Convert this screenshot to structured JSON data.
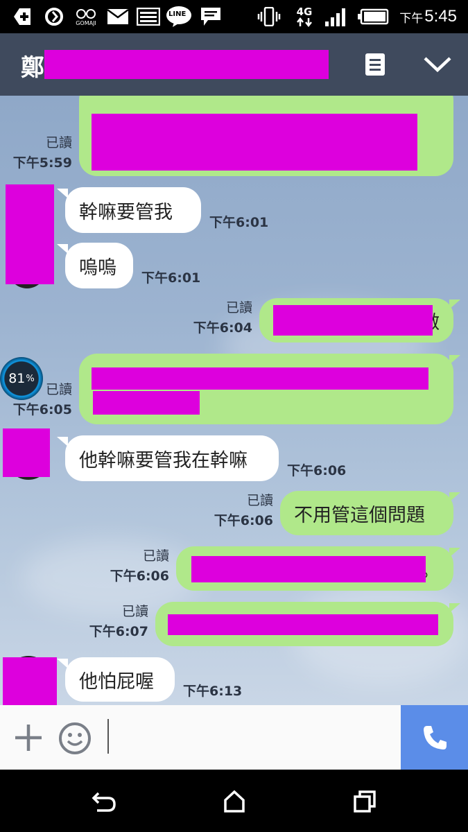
{
  "status_bar": {
    "time_prefix": "下午",
    "time": "5:45",
    "network_label": "4G",
    "app_label": "GOMAJI",
    "line_label": "LINE"
  },
  "header": {
    "title_visible": "鄭",
    "icons": [
      "notes-icon",
      "chevron-down-icon"
    ]
  },
  "messages": [
    {
      "dir": "out",
      "text": "",
      "read": "已讀",
      "time": "下午5:59"
    },
    {
      "dir": "in",
      "text": "幹嘛要管我",
      "time": "下午6:01"
    },
    {
      "dir": "in",
      "text": "嗚嗚",
      "time": "下午6:01"
    },
    {
      "dir": "out",
      "text": "",
      "suffix": "做",
      "read": "已讀",
      "time": "下午6:04"
    },
    {
      "dir": "out",
      "text": "",
      "read": "已讀",
      "time": "下午6:05"
    },
    {
      "dir": "in",
      "text": "他幹嘛要管我在幹嘛",
      "time": "下午6:06"
    },
    {
      "dir": "out",
      "text": "不用管這個問題",
      "read": "已讀",
      "time": "下午6:06"
    },
    {
      "dir": "out",
      "text": "",
      "suffix": "。",
      "read": "已讀",
      "time": "下午6:06"
    },
    {
      "dir": "out",
      "text": "",
      "read": "已讀",
      "time": "下午6:07"
    },
    {
      "dir": "in",
      "text": "他怕屁喔",
      "time": "下午6:13"
    }
  ],
  "battery_widget": {
    "value": "81",
    "unit": "%"
  },
  "colors": {
    "header_bg": "#3f4a5d",
    "out_bubble": "#b0e88a",
    "in_bubble": "#ffffff",
    "call_button": "#5b8de8",
    "redaction": "#dd00dd"
  }
}
